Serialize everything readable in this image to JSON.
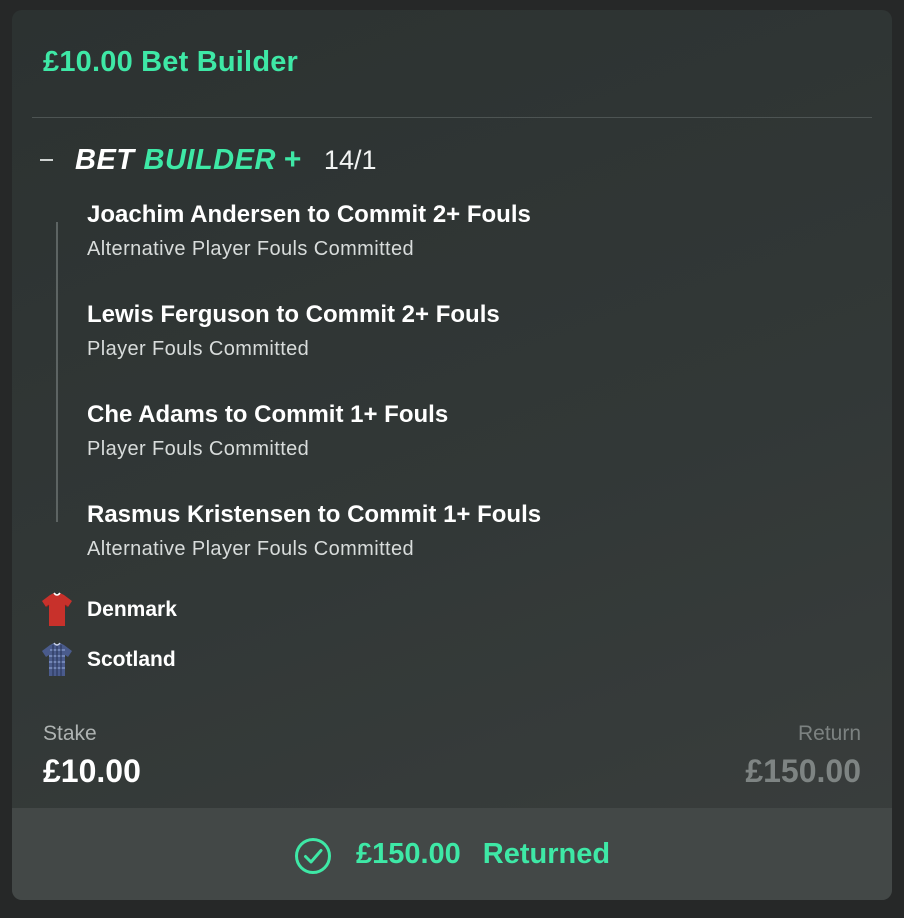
{
  "card": {
    "title": "£10.00 Bet Builder"
  },
  "bet_builder": {
    "logo_word_1": "BET",
    "logo_word_2": "BUILDER",
    "logo_plus": "+",
    "odds": "14/1",
    "legs": [
      {
        "title": "Joachim Andersen to Commit 2+ Fouls",
        "market": "Alternative Player Fouls Committed"
      },
      {
        "title": "Lewis Ferguson to Commit 2+ Fouls",
        "market": "Player Fouls Committed"
      },
      {
        "title": "Che Adams to Commit 1+ Fouls",
        "market": "Player Fouls Committed"
      },
      {
        "title": "Rasmus Kristensen to Commit 1+ Fouls",
        "market": "Alternative Player Fouls Committed"
      }
    ]
  },
  "teams": [
    {
      "name": "Denmark",
      "icon": "denmark-shirt-icon",
      "color": "#c8312b"
    },
    {
      "name": "Scotland",
      "icon": "scotland-shirt-icon",
      "color": "#4a5b8c"
    }
  ],
  "stake": {
    "label": "Stake",
    "value": "£10.00"
  },
  "return": {
    "label": "Return",
    "value": "£150.00"
  },
  "footer": {
    "amount": "£150.00",
    "status": "Returned",
    "icon": "check-circle-icon"
  },
  "colors": {
    "accent": "#3ee8a6",
    "card_bg": "#323837",
    "footer_bg": "#434847"
  }
}
